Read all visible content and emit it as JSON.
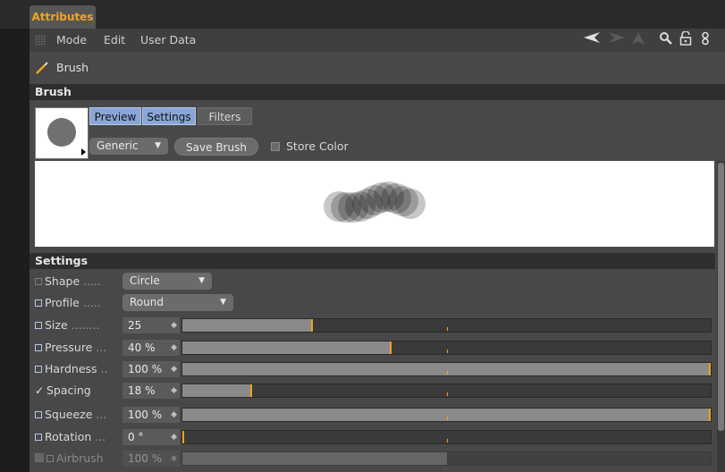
{
  "tab": {
    "label": "Attributes"
  },
  "menubar": {
    "items": [
      "Mode",
      "Edit",
      "User Data"
    ],
    "icons": [
      "back-arrow-icon",
      "forward-arrow-icon",
      "up-arrow-icon",
      "search-icon",
      "lock-icon",
      "link-icon"
    ]
  },
  "object": {
    "name": "Brush"
  },
  "brush_section": {
    "title": "Brush",
    "tabs": [
      {
        "label": "Preview",
        "active": true
      },
      {
        "label": "Settings",
        "active": true
      },
      {
        "label": "Filters",
        "active": false
      }
    ],
    "preset": "Generic",
    "save_label": "Save Brush",
    "store_color_label": "Store Color"
  },
  "settings_section": {
    "title": "Settings",
    "shape": {
      "label": "Shape",
      "value": "Circle"
    },
    "profile": {
      "label": "Profile",
      "value": "Round"
    },
    "params": [
      {
        "label": "Size",
        "value": "25",
        "fraction": 0.245,
        "mark": "box"
      },
      {
        "label": "Pressure",
        "value": "40 %",
        "fraction": 0.395,
        "mark": "box"
      },
      {
        "label": "Hardness",
        "value": "100 %",
        "fraction": 1.0,
        "mark": "box"
      },
      {
        "label": "Spacing",
        "value": "18 %",
        "fraction": 0.13,
        "mark": "check"
      },
      {
        "label": "Squeeze",
        "value": "100 %",
        "fraction": 1.0,
        "mark": "box"
      },
      {
        "label": "Rotation",
        "value": "0 °",
        "fraction": 0.0,
        "mark": "box"
      },
      {
        "label": "Airbrush",
        "value": "100 %",
        "fraction": 0.5,
        "mark": "disabled"
      }
    ]
  },
  "colors": {
    "accent": "#f2a31a",
    "tab_active": "#8aa6d8",
    "panel": "#484848",
    "header": "#2e2e2e"
  }
}
